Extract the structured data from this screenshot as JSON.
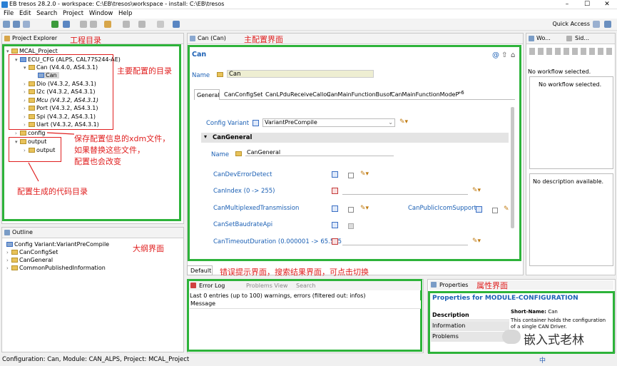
{
  "window": {
    "title": "EB tresos 28.2.0 - workspace: C:\\EB\\tresos\\workspace - install: C:\\EB\\tresos",
    "min": "–",
    "max": "☐",
    "close": "✕"
  },
  "menu": [
    "File",
    "Edit",
    "Search",
    "Project",
    "Window",
    "Help"
  ],
  "toolbar": {
    "quick_access": "Quick Access"
  },
  "project_explorer": {
    "tab": "Project Explorer",
    "items": [
      "MCAL_Project",
      "ECU_CFG (ALPS, CAL77S244-AE)",
      "Can (V4.4.0, AS4.3.1)",
      "Can",
      "Dio (V4.3.2, AS4.3.1)",
      "I2c (V4.3.2, AS4.3.1)",
      "Mcu (V4.3.2, AS4.3.1)",
      "Port (V4.3.2, AS4.3.1)",
      "Spi (V4.3.2, AS4.3.1)",
      "Uart (V4.3.2, AS4.3.1)",
      "config",
      "output",
      "output"
    ]
  },
  "outline": {
    "tab": "Outline",
    "items": [
      "Config Variant:VariantPreCompile",
      "CanConfigSet",
      "CanGeneral",
      "CommonPublishedInformation"
    ]
  },
  "editor": {
    "tab": "Can (Can)",
    "header": "Can",
    "name_label": "Name",
    "name_value": "Can",
    "tabs": [
      "General",
      "CanConfigSet",
      "CanLPduReceiveCallou",
      "CanMainFunctionBusof",
      "CanMainFunctionModeP",
      "»6"
    ],
    "config_variant_label": "Config Variant",
    "config_variant_value": "VariantPreCompile",
    "section": "CanGeneral",
    "section_name_label": "Name",
    "section_name_value": "CanGeneral",
    "params": [
      "CanDevErrorDetect",
      "CanIndex (0 -> 255)",
      "CanMultiplexedTransmission",
      "CanSetBaudrateApi",
      "CanTimeoutDuration (0.000001 -> 65.535)"
    ],
    "param_right": "CanPublicIcomSupport",
    "bottom_tab": "Default"
  },
  "workflow": {
    "tab1": "Wo...",
    "tab2": "Sid...",
    "status": "No workflow selected.",
    "message": "No workflow selected.",
    "description": "No description available."
  },
  "errorlog": {
    "tabs": [
      "Error Log",
      "Problems View",
      "Search"
    ],
    "summary": "Last 0 entries (up to 100) warnings, errors (filtered out: infos)",
    "column": "Message"
  },
  "properties": {
    "tab": "Properties",
    "header": "Properties for MODULE-CONFIGURATION",
    "rows": [
      "Description",
      "Information",
      "Problems"
    ],
    "short_name_label": "Short-Name:",
    "short_name_value": "Can",
    "desc_text": "This container holds the configuration of a single CAN Driver."
  },
  "statusbar": {
    "text": "Configuration: Can, Module: CAN_ALPS, Project: MCAL_Project",
    "watermark": "嵌入式老林",
    "ime": "中"
  },
  "annotations": {
    "project_dir": "工程目录",
    "main_config_ui": "主配置界面",
    "main_config_dir": "主要配置的目录",
    "xdm_line1": "保存配置信息的xdm文件，",
    "xdm_line2": "如果替换这些文件，",
    "xdm_line3": "配置也会改变",
    "output_dir": "配置生成的代码目录",
    "outline_ui": "大纲界面",
    "error_ui": "错误提示界面，搜索结果界面，可点击切换",
    "properties_ui": "属性界面"
  },
  "colors": {
    "highlight_green": "#2db33a",
    "annotation_red": "#e02020",
    "link_blue": "#1a5fb4",
    "header_blue": "#1a5fb4"
  }
}
